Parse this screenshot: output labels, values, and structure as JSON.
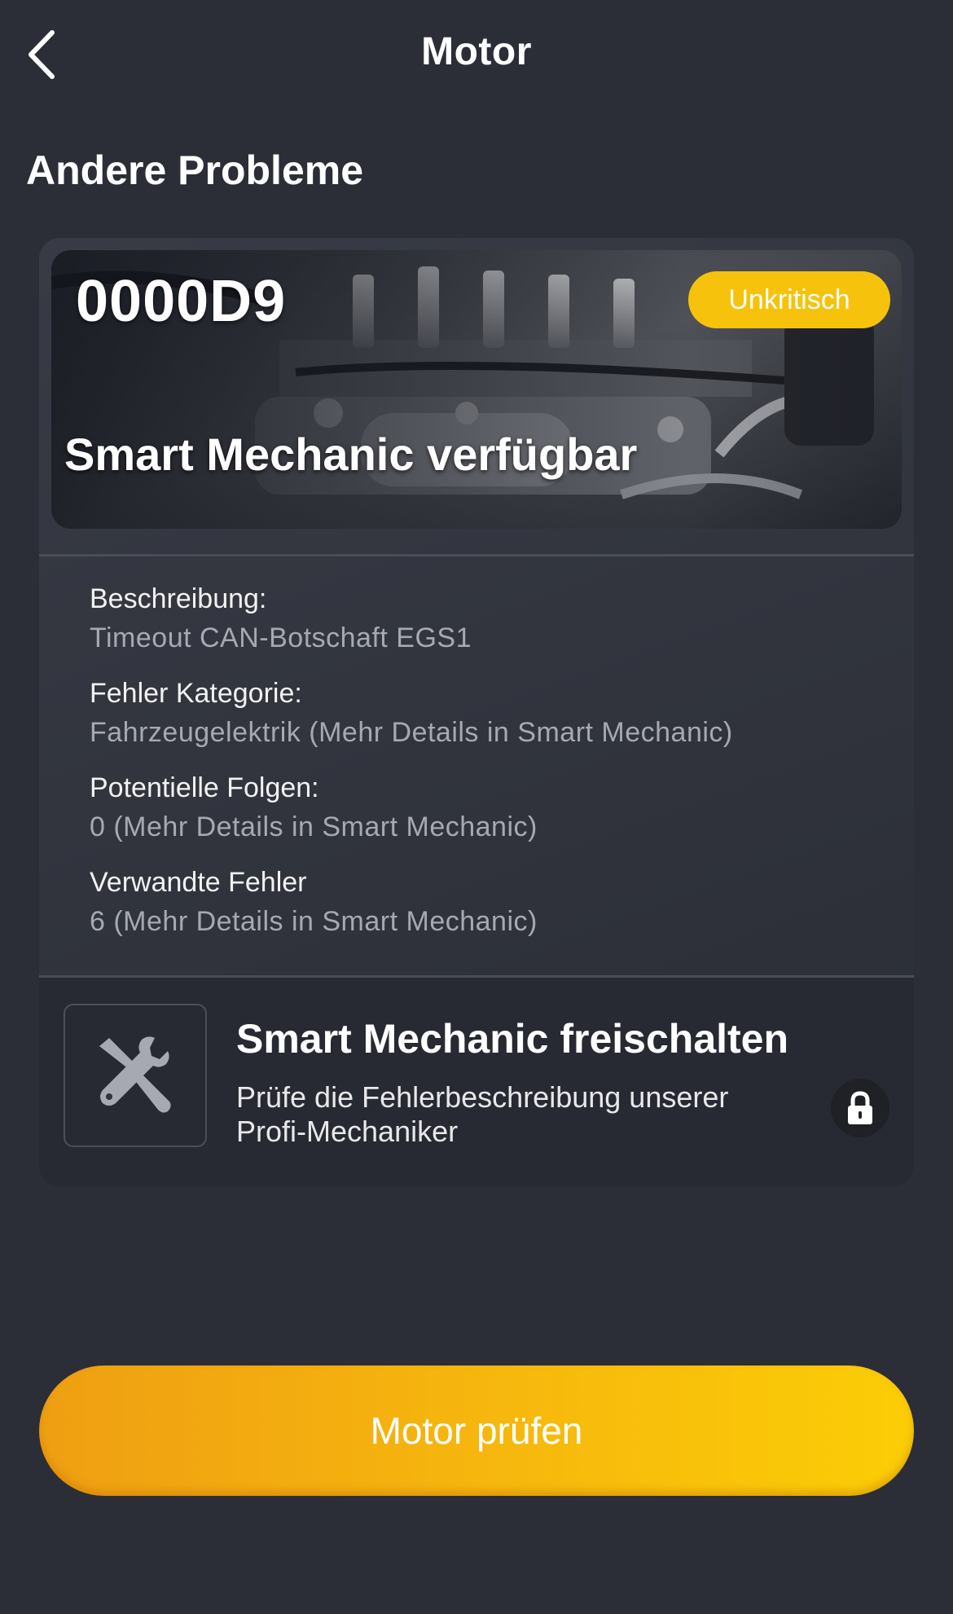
{
  "nav": {
    "title": "Motor"
  },
  "section": {
    "title": "Andere Probleme"
  },
  "problem": {
    "code": "0000D9",
    "severity": "Unkritisch",
    "subtitle": "Smart Mechanic verfügbar",
    "details": [
      {
        "label": "Beschreibung:",
        "value": "Timeout CAN-Botschaft EGS1"
      },
      {
        "label": "Fehler Kategorie:",
        "value": "Fahrzeugelektrik (Mehr Details in Smart Mechanic)"
      },
      {
        "label": "Potentielle Folgen:",
        "value": "0 (Mehr Details in Smart Mechanic)"
      },
      {
        "label": "Verwandte Fehler",
        "value": "6 (Mehr Details in Smart Mechanic)"
      }
    ]
  },
  "unlock": {
    "title": "Smart Mechanic freischalten",
    "subtitle": "Prüfe die Fehlerbeschreibung unserer Profi-Mechaniker",
    "icon": "tools-icon",
    "lock_icon": "lock-icon"
  },
  "cta": {
    "label": "Motor prüfen"
  },
  "colors": {
    "background": "#2b2e37",
    "accent": "#f6c20b",
    "cta_start": "#ef9f12",
    "cta_end": "#fccd06"
  }
}
